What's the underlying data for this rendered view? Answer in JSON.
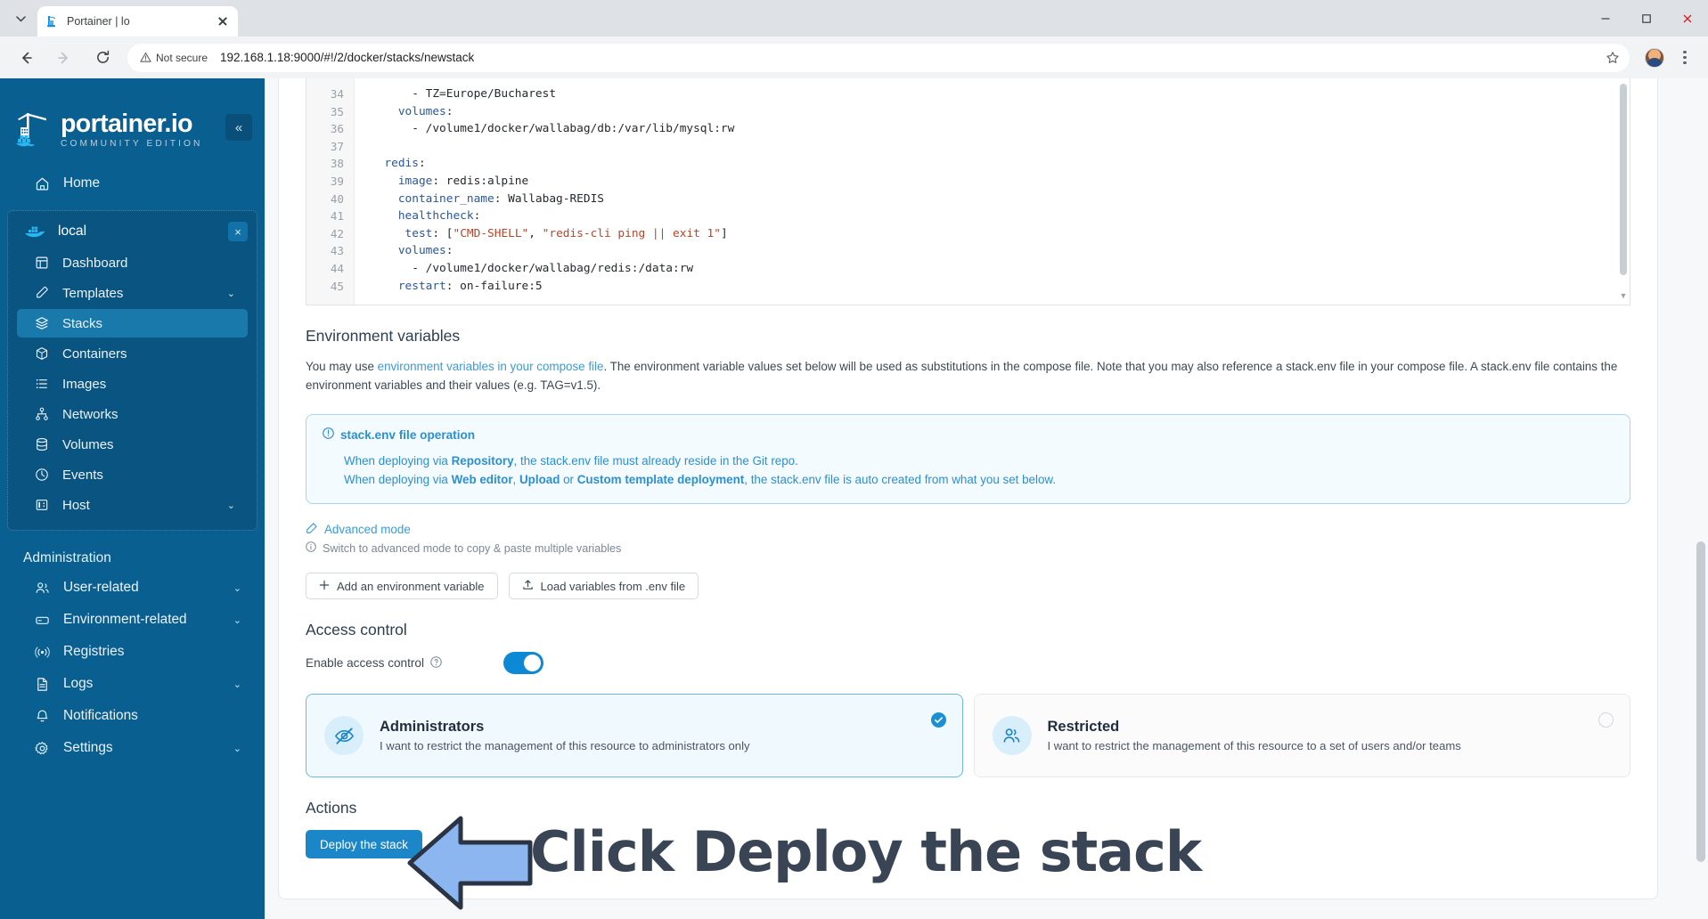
{
  "browser": {
    "tab_title": "Portainer | lo",
    "url": "192.168.1.18:9000/#!/2/docker/stacks/newstack",
    "security_label": "Not secure",
    "icons": {
      "tab_list": "chevron-down-icon",
      "back": "back-arrow-icon",
      "forward": "forward-arrow-icon",
      "reload": "reload-icon",
      "bookmark": "star-icon",
      "menu": "kebab-menu-icon",
      "minimize": "minimize-icon",
      "maximize": "maximize-icon",
      "close": "window-close-icon"
    }
  },
  "sidebar": {
    "logo_primary": "portainer.io",
    "logo_secondary": "COMMUNITY EDITION",
    "collapse_label": "«",
    "home": {
      "label": "Home",
      "icon": "home-icon"
    },
    "environment": {
      "label": "local",
      "icon": "docker-whale-icon",
      "close": "×"
    },
    "env_items": [
      {
        "label": "Dashboard",
        "icon": "dashboard-icon",
        "chevron": "",
        "active": false
      },
      {
        "label": "Templates",
        "icon": "template-edit-icon",
        "chevron": "⌄",
        "active": false
      },
      {
        "label": "Stacks",
        "icon": "stacks-layers-icon",
        "chevron": "",
        "active": true
      },
      {
        "label": "Containers",
        "icon": "container-box-icon",
        "chevron": "",
        "active": false
      },
      {
        "label": "Images",
        "icon": "images-list-icon",
        "chevron": "",
        "active": false
      },
      {
        "label": "Networks",
        "icon": "networks-icon",
        "chevron": "",
        "active": false
      },
      {
        "label": "Volumes",
        "icon": "volumes-database-icon",
        "chevron": "",
        "active": false
      },
      {
        "label": "Events",
        "icon": "events-clock-icon",
        "chevron": "",
        "active": false
      },
      {
        "label": "Host",
        "icon": "host-server-icon",
        "chevron": "⌄",
        "active": false
      }
    ],
    "administration_title": "Administration",
    "admin_items": [
      {
        "label": "User-related",
        "icon": "users-icon",
        "chevron": "⌄"
      },
      {
        "label": "Environment-related",
        "icon": "environment-box-icon",
        "chevron": "⌄"
      },
      {
        "label": "Registries",
        "icon": "registry-broadcast-icon",
        "chevron": ""
      },
      {
        "label": "Logs",
        "icon": "logs-document-icon",
        "chevron": "⌄"
      },
      {
        "label": "Notifications",
        "icon": "bell-icon",
        "chevron": ""
      },
      {
        "label": "Settings",
        "icon": "gear-icon",
        "chevron": "⌄"
      }
    ]
  },
  "editor": {
    "line_numbers": [
      "34",
      "35",
      "36",
      "37",
      "38",
      "39",
      "40",
      "41",
      "42",
      "43",
      "44",
      "45"
    ],
    "lines": [
      "      - TZ=Europe/Bucharest",
      "    volumes:",
      "      - /volume1/docker/wallabag/db:/var/lib/mysql:rw",
      "",
      "  redis:",
      "    image: redis:alpine",
      "    container_name: Wallabag-REDIS",
      "    healthcheck:",
      "     test: [\"CMD-SHELL\", \"redis-cli ping || exit 1\"]",
      "    volumes:",
      "      - /volume1/docker/wallabag/redis:/data:rw",
      "    restart: on-failure:5"
    ]
  },
  "env_section": {
    "title": "Environment variables",
    "paragraph_pre": "You may use ",
    "paragraph_link": "environment variables in your compose file",
    "paragraph_post": ". The environment variable values set below will be used as substitutions in the compose file. Note that you may also reference a stack.env file in your compose file. A stack.env file contains the environment variables and their values (e.g. TAG=v1.5).",
    "info": {
      "icon": "info-circle-icon",
      "title": "stack.env file operation",
      "line1_a": "When deploying via ",
      "line1_b": "Repository",
      "line1_c": ", the stack.env file must already reside in the Git repo.",
      "line2_a": "When deploying via ",
      "line2_b": "Web editor",
      "line2_c": ", ",
      "line2_d": "Upload",
      "line2_e": " or ",
      "line2_f": "Custom template deployment",
      "line2_g": ", the stack.env file is auto created from what you set below."
    },
    "advanced_mode": "Advanced mode",
    "advanced_mode_icon": "pencil-square-icon",
    "advanced_hint": "Switch to advanced mode to copy & paste multiple variables",
    "advanced_hint_icon": "info-circle-icon",
    "add_var_button": "Add an environment variable",
    "add_var_icon": "plus-icon",
    "load_env_button": "Load variables from .env file",
    "load_env_icon": "upload-icon"
  },
  "access_control": {
    "title": "Access control",
    "toggle_label": "Enable access control",
    "toggle_help_icon": "question-circle-icon",
    "toggle_on": true,
    "options": [
      {
        "title": "Administrators",
        "description": "I want to restrict the management of this resource to administrators only",
        "icon": "eye-off-icon",
        "selected": true
      },
      {
        "title": "Restricted",
        "description": "I want to restrict the management of this resource to a set of users and/or teams",
        "icon": "users-group-icon",
        "selected": false
      }
    ]
  },
  "actions": {
    "title": "Actions",
    "deploy_button": "Deploy the stack"
  },
  "annotation": {
    "text": "Click Deploy the stack",
    "arrow_icon": "left-arrow-annotation",
    "arrow_fill": "#8cb6f0",
    "arrow_stroke": "#2b3444",
    "text_color": "#394455"
  },
  "colors": {
    "sidebar_bg": "#0a5f91",
    "accent": "#1b87c9",
    "active_nav": "#1a79ab",
    "link": "#3a9bd9"
  }
}
